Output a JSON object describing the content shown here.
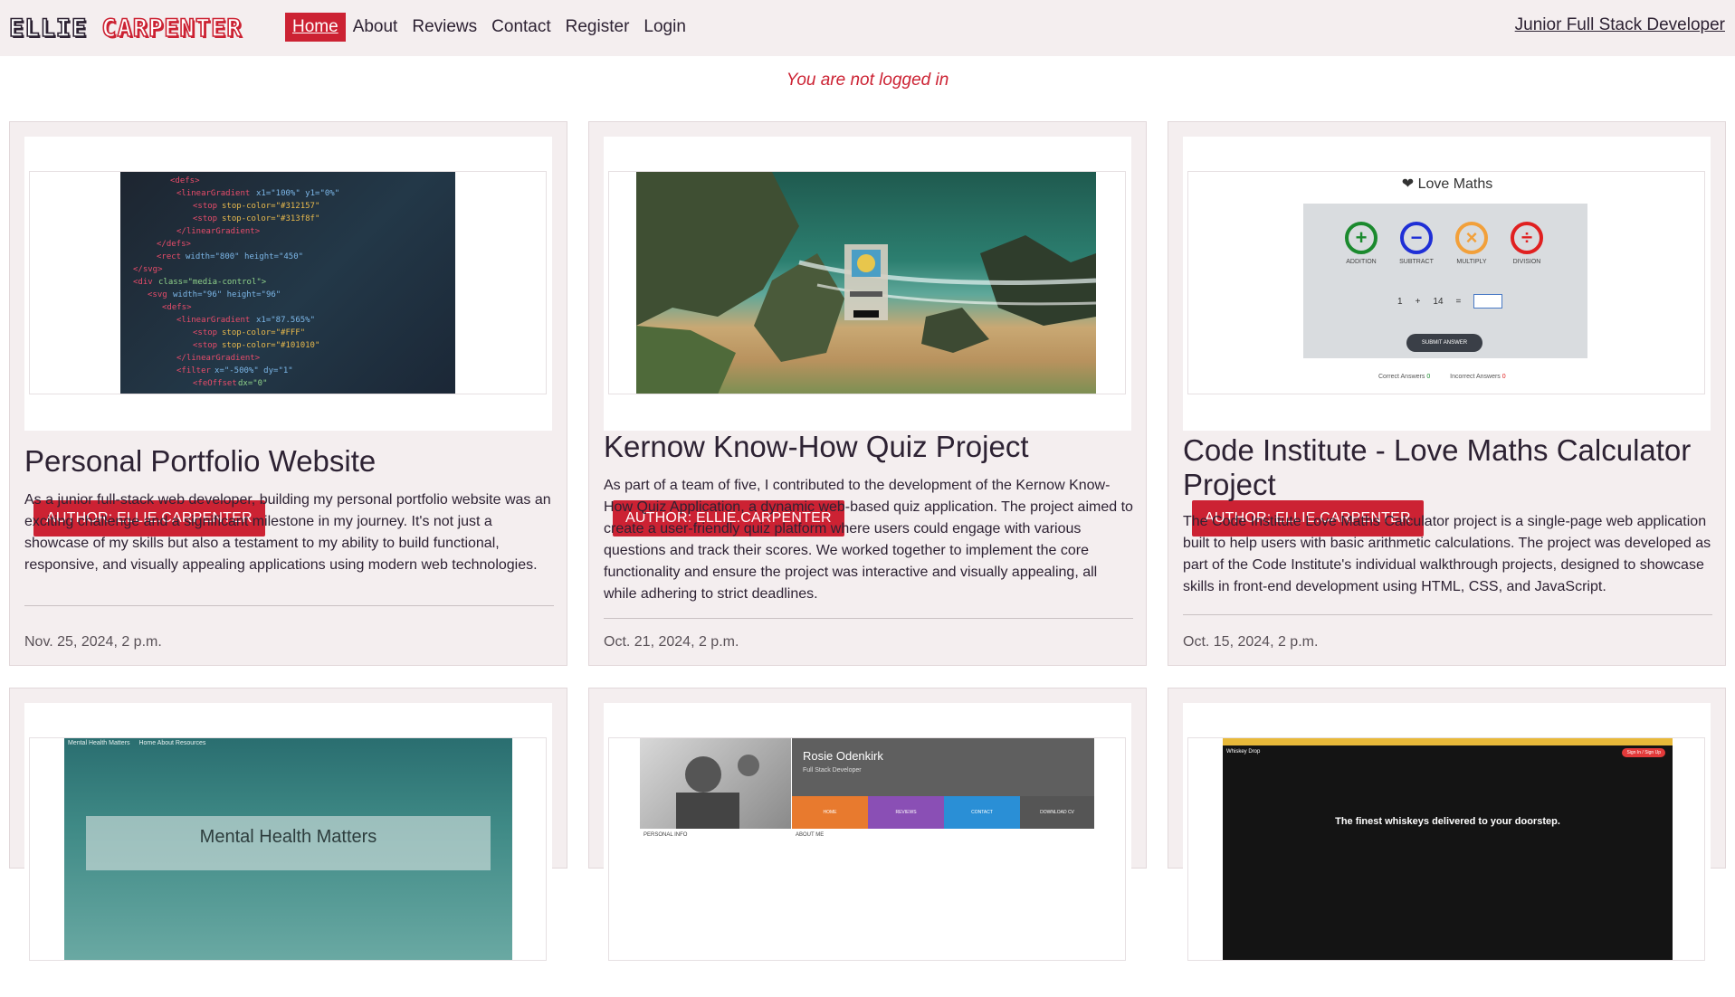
{
  "brand": {
    "first": "ELLIE",
    "last": "CARPENTER"
  },
  "nav": {
    "links": [
      {
        "label": "Home",
        "active": true
      },
      {
        "label": "About"
      },
      {
        "label": "Reviews"
      },
      {
        "label": "Contact"
      },
      {
        "label": "Register"
      },
      {
        "label": "Login"
      }
    ],
    "tagline": "Junior Full Stack Developer"
  },
  "status": {
    "login_message": "You are not logged in"
  },
  "colors": {
    "accent": "#cc2233",
    "nav_bg": "#f4eeef",
    "text": "#2d2233"
  },
  "posts": [
    {
      "author_badge": "AUTHOR: ELLIE.CARPENTER",
      "title": "Personal Portfolio Website",
      "description": "As a junior full-stack web developer, building my personal portfolio website was an exciting challenge and a significant milestone in my journey. It's not just a showcase of my skills but also a testament to my ability to build functional, responsive, and visually appealing applications using modern web technologies.",
      "date": "Nov. 25, 2024, 2 p.m."
    },
    {
      "author_badge": "AUTHOR: ELLIE.CARPENTER",
      "title": "Kernow Know-How Quiz Project",
      "description": "As part of a team of five, I contributed to the development of the Kernow Know-How Quiz Application, a dynamic web-based quiz application. The project aimed to create a user-friendly quiz platform where users could engage with various questions and track their scores. We worked together to implement the core functionality and ensure the project was interactive and visually appealing, all while adhering to strict deadlines.",
      "date": "Oct. 21, 2024, 2 p.m."
    },
    {
      "author_badge": "AUTHOR: ELLIE.CARPENTER",
      "title": "Code Institute - Love Maths Calculator Project",
      "description": "The Code Institute Love Maths Calculator project is a single-page web application built to help users with basic arithmetic calculations. The project was developed as part of the Code Institute's individual walkthrough projects, designed to showcase skills in front-end development using HTML, CSS, and JavaScript.",
      "date": "Oct. 15, 2024, 2 p.m.",
      "thumbnail": {
        "heading": "Love Maths",
        "ops": [
          "ADDITION",
          "SUBTRACT",
          "MULTIPLY",
          "DIVISION"
        ],
        "question": {
          "a": "1",
          "op": "+",
          "b": "14",
          "eq": "="
        },
        "submit": "SUBMIT ANSWER",
        "correct": "Correct Answers",
        "correct_count": "0",
        "incorrect": "Incorrect Answers",
        "incorrect_count": "0"
      }
    },
    {
      "thumbnail": {
        "nav_title": "Mental Health Matters",
        "nav_items": "Home   About   Resources",
        "hero_title": "Mental Health Matters"
      }
    },
    {
      "thumbnail": {
        "name": "Rosie Odenkirk",
        "role": "Full Stack Developer",
        "tiles": [
          "HOME",
          "REVIEWS",
          "CONTACT",
          "DOWNLOAD CV"
        ],
        "col1": "PERSONAL INFO",
        "col2": "ABOUT ME"
      }
    },
    {
      "thumbnail": {
        "nav_title": "Whiskey Drop",
        "hero": "The finest whiskeys delivered to your doorstep.",
        "cta": "Sign In / Sign Up"
      }
    }
  ]
}
